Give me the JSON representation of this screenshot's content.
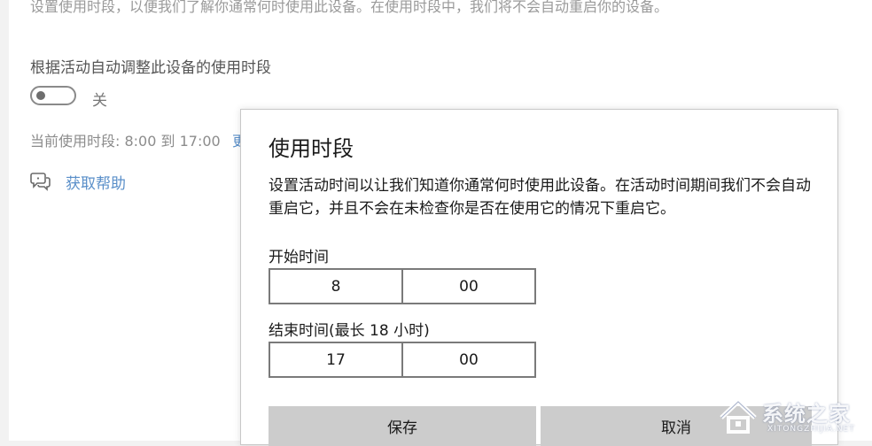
{
  "settings": {
    "top_description": "设置使用时段，以便我们了解你通常何时使用此设备。在使用时段中，我们将不会自动重启你的设备。",
    "auto_adjust_title": "根据活动自动调整此设备的使用时段",
    "toggle_state": "关",
    "current_hours": "当前使用时段: 8:00 到 17:00",
    "change_link": "更改",
    "help_link": "获取帮助"
  },
  "dialog": {
    "title": "使用时段",
    "description": "设置活动时间以让我们知道你通常何时使用此设备。在活动时间期间我们不会自动重启它，并且不会在未检查你是否在使用它的情况下重启它。",
    "start_label": "开始时间",
    "start_hour": "8",
    "start_minute": "00",
    "end_label": "结束时间(最长 18 小时)",
    "end_hour": "17",
    "end_minute": "00",
    "save_label": "保存",
    "cancel_label": "取消"
  },
  "watermark": {
    "text": "系统之家",
    "sub": "XITONGZHIJIA.NET"
  },
  "colors": {
    "link": "#5a8fc9",
    "button_bg": "#cccccc"
  },
  "icons": {
    "help": "chat-bubble-help-icon",
    "logo": "house-logo-icon"
  }
}
